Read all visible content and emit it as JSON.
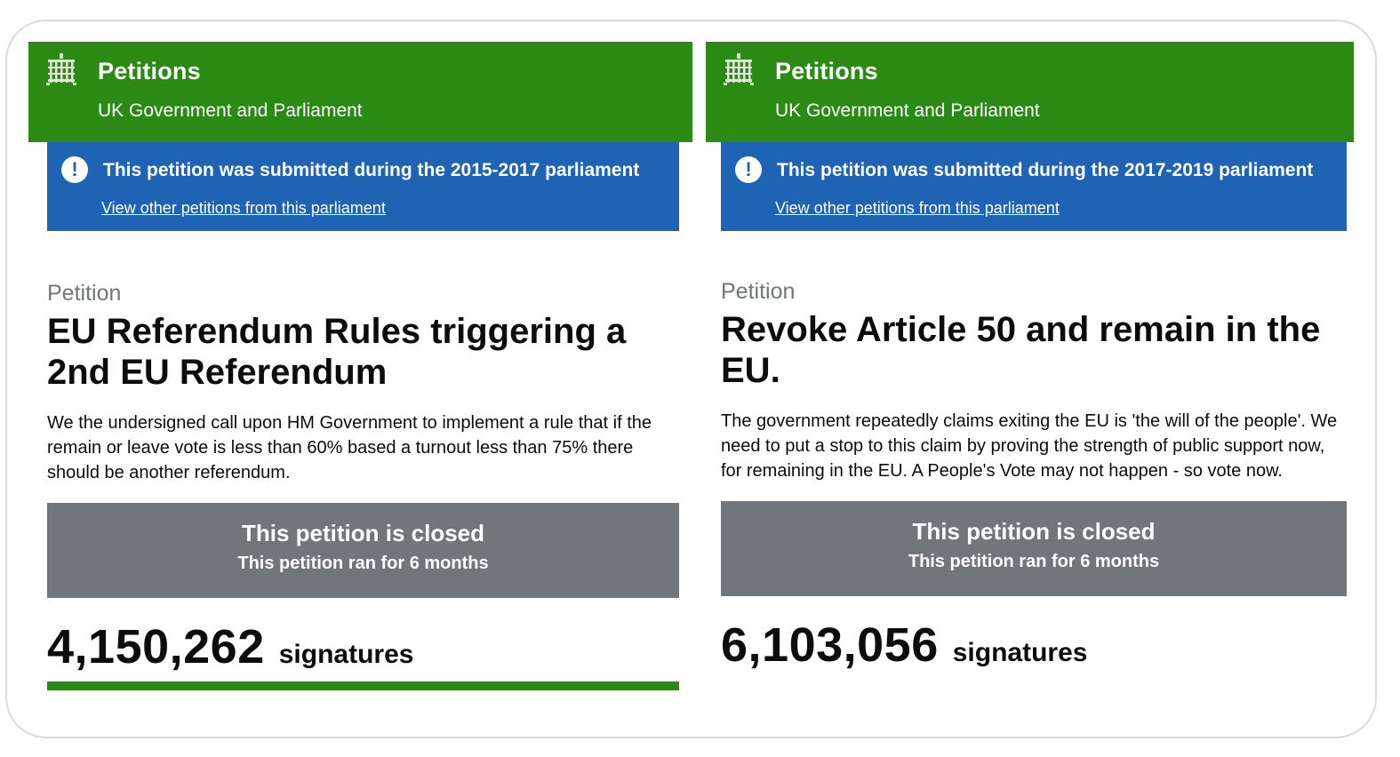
{
  "petitions": [
    {
      "site_title": "Petitions",
      "site_subtitle": "UK Government and Parliament",
      "banner_message": "This petition was submitted during the 2015-2017 parliament",
      "banner_link": "View other petitions from this parliament",
      "kicker": "Petition",
      "title": "EU Referendum Rules triggering a 2nd EU Referendum",
      "description": "We the undersigned call upon HM Government to implement a rule that if the remain or leave vote is less than 60% based a turnout less than 75% there should be another referendum.",
      "closed_title": "This petition is closed",
      "closed_subtitle": "This petition ran for 6 months",
      "signatures": "4,150,262",
      "signatures_label": "signatures",
      "progress_fraction": 1.0,
      "colors": {
        "header": "#2b8a14",
        "banner": "#1f63b4",
        "closed": "#6f777b"
      }
    },
    {
      "site_title": "Petitions",
      "site_subtitle": "UK Government and Parliament",
      "banner_message": "This petition was submitted during the 2017-2019 parliament",
      "banner_link": "View other petitions from this parliament",
      "kicker": "Petition",
      "title": "Revoke Article 50 and remain in the EU.",
      "description": "The government repeatedly claims exiting the EU is 'the will of the people'. We need to put a stop to this claim by proving the strength of public support now, for remaining in the EU. A People's Vote may not happen - so vote now.",
      "closed_title": "This petition is closed",
      "closed_subtitle": "This petition ran for 6 months",
      "signatures": "6,103,056",
      "signatures_label": "signatures",
      "colors": {
        "header": "#2b8a14",
        "banner": "#1f63b4",
        "closed": "#6f777b"
      }
    }
  ],
  "icons": {
    "crest": "parliament-portcullis-icon",
    "alert": "exclamation-circle-icon"
  }
}
